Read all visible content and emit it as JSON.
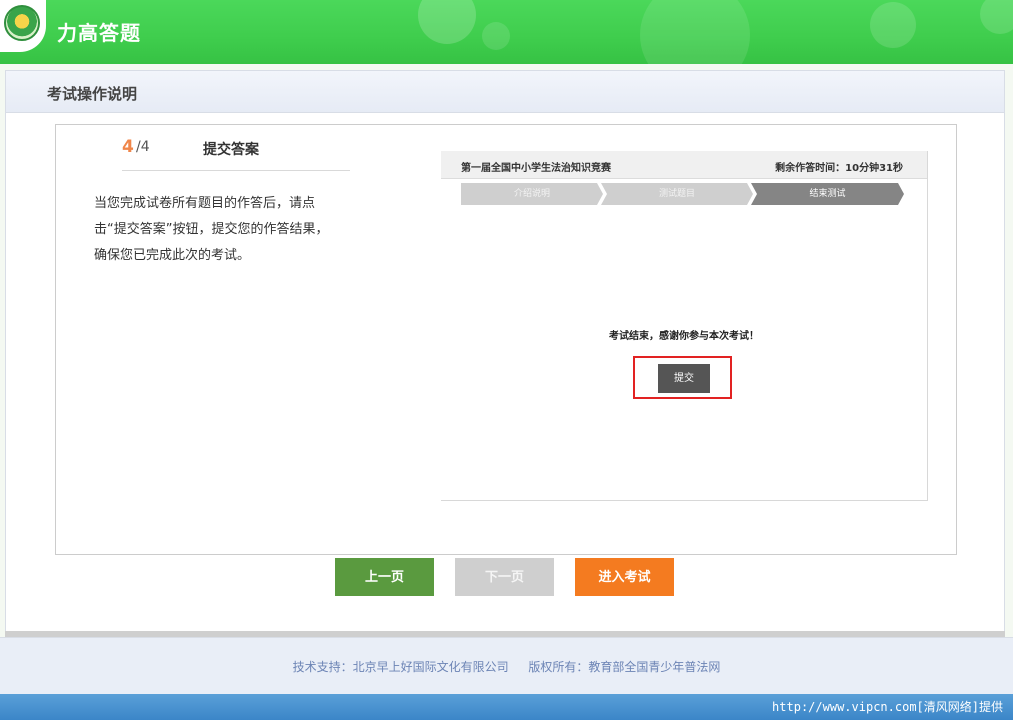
{
  "app": {
    "title": "力高答题"
  },
  "panel": {
    "title": "考试操作说明",
    "step": {
      "current": "4",
      "total": "/4",
      "title": "提交答案"
    },
    "description_lines": [
      "当您完成试卷所有题目的作答后，请点",
      "击“提交答案”按钮，提交您的作答结果，",
      "确保您已完成此次的考试。"
    ]
  },
  "illustration": {
    "exam_name": "第一届全国中小学生法治知识竞赛",
    "time_left": "剩余作答时间：10分钟31秒",
    "steps": [
      "介绍说明",
      "测试题目",
      "结束测试"
    ],
    "thanks_text": "考试结束，感谢你参与本次考试！",
    "submit_label": "提交"
  },
  "nav": {
    "prev_label": "上一页",
    "next_label": "下一页",
    "enter_label": "进入考试"
  },
  "footer": {
    "support": "技术支持：北京早上好国际文化有限公司",
    "copyright": "版权所有：教育部全国青少年普法网"
  },
  "watermark": "http://www.vipcn.com[清风网络]提供",
  "colors": {
    "header_green": "#3fcd4d",
    "step_accent": "#f0864a",
    "prev_button": "#5a9a3f",
    "next_button_disabled": "#cfcfcf",
    "enter_button": "#f47b20",
    "highlight_frame": "#e22222"
  }
}
